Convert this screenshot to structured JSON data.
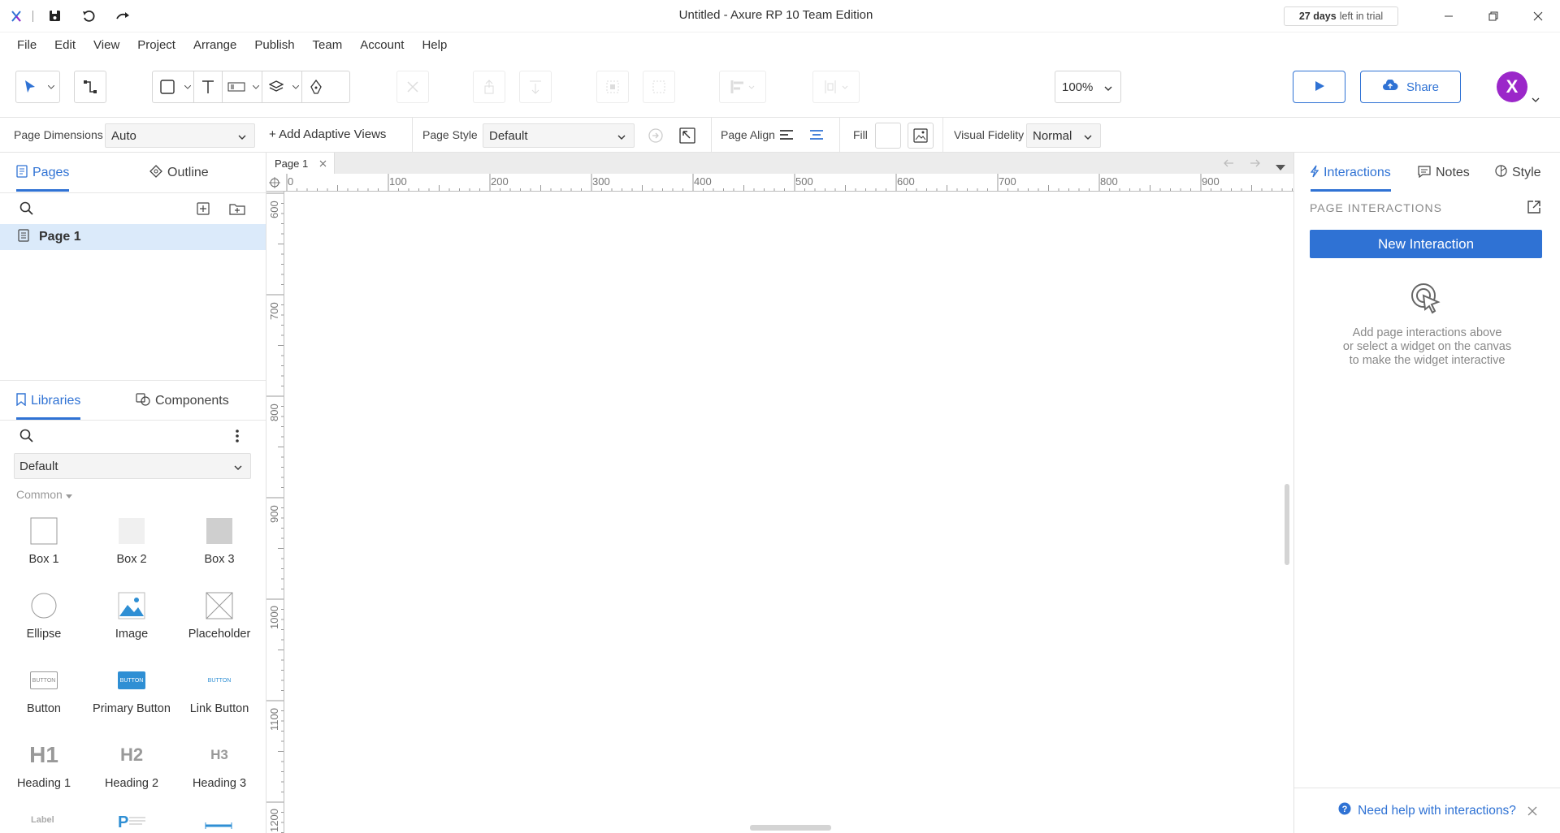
{
  "window": {
    "title": "Untitled - Axure RP 10 Team Edition",
    "trial_days": "27 days",
    "trial_suffix": "left in trial"
  },
  "menu": [
    "File",
    "Edit",
    "View",
    "Project",
    "Arrange",
    "Publish",
    "Team",
    "Account",
    "Help"
  ],
  "toolbar": {
    "zoom": "100%",
    "share_label": "Share",
    "avatar_letter": "X",
    "accent": "#2f72d4",
    "avatar_color": "#9b27c9"
  },
  "page_props": {
    "dimensions_label": "Page Dimensions",
    "dimensions_value": "Auto",
    "add_adaptive": "+ Add Adaptive Views",
    "style_label": "Page Style",
    "style_value": "Default",
    "align_label": "Page Align",
    "fill_label": "Fill",
    "fidelity_label": "Visual Fidelity",
    "fidelity_value": "Normal"
  },
  "left": {
    "tab_pages": "Pages",
    "tab_outline": "Outline",
    "page_name": "Page 1",
    "tab_libraries": "Libraries",
    "tab_components": "Components",
    "library": "Default",
    "section": "Common",
    "widgets": [
      "Box 1",
      "Box 2",
      "Box 3",
      "Ellipse",
      "Image",
      "Placeholder",
      "Button",
      "Primary Button",
      "Link Button",
      "Heading 1",
      "Heading 2",
      "Heading 3"
    ],
    "widget_icon_text": {
      "button": "BUTTON",
      "h1": "H1",
      "h2": "H2",
      "h3": "H3",
      "label": "Label"
    }
  },
  "canvas": {
    "tab_name": "Page 1",
    "ruler_x": [
      "0",
      "100",
      "200",
      "300",
      "400",
      "500",
      "600",
      "700",
      "800",
      "900"
    ],
    "ruler_y": [
      "600",
      "700",
      "800",
      "900",
      "1000",
      "1100",
      "1200"
    ]
  },
  "right": {
    "tab_interactions": "Interactions",
    "tab_notes": "Notes",
    "tab_style": "Style",
    "section_title": "PAGE INTERACTIONS",
    "new_interaction": "New Interaction",
    "hint_1": "Add page interactions above",
    "hint_2": "or select a widget on the canvas",
    "hint_3": "to make the widget interactive",
    "help": "Need help with interactions?"
  }
}
